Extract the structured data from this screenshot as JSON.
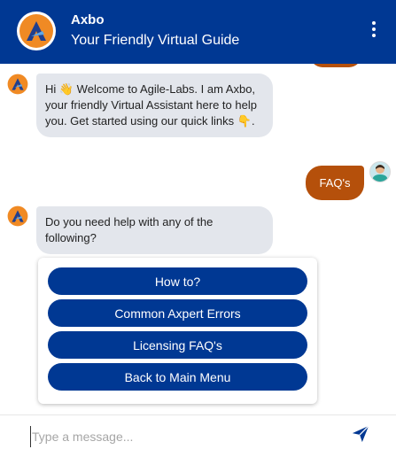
{
  "header": {
    "title": "Axbo",
    "subtitle": "Your Friendly Virtual Guide"
  },
  "messages": {
    "welcome_text": "Hi 👋 Welcome to Agile-Labs. I am Axbo, your friendly Virtual Assistant here to help you. Get started using our quick links 👇.",
    "user_text": "FAQ's",
    "question_text": "Do you need help with any of the following?"
  },
  "options": [
    "How to?",
    "Common Axpert Errors",
    "Licensing FAQ's",
    "Back to Main Menu"
  ],
  "composer": {
    "placeholder": "Type a message..."
  },
  "colors": {
    "brand_blue": "#003893",
    "user_bubble": "#b5500b",
    "bot_bubble": "#e3e6ec",
    "logo_orange": "#f08a24"
  },
  "icons": {
    "logo": "axbo-logo-icon",
    "menu": "kebab-menu-icon",
    "send": "send-icon",
    "user": "user-avatar-icon"
  }
}
